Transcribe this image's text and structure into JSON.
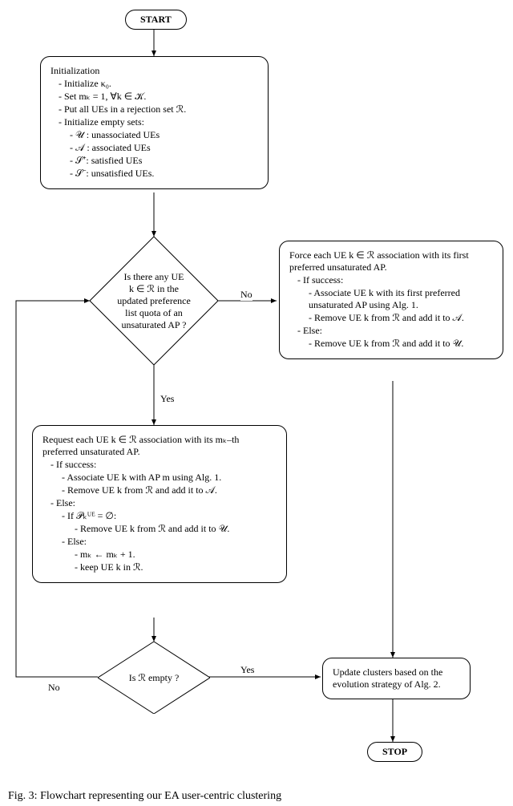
{
  "chart_data": {
    "type": "flowchart",
    "title": "Flowchart representing our EA user-centric clustering",
    "nodes": [
      {
        "id": "start",
        "type": "terminal",
        "label": "START"
      },
      {
        "id": "init",
        "type": "process",
        "label": "Initialization"
      },
      {
        "id": "dec1",
        "type": "decision",
        "label": "Is there any UE k ∈ ℛ in the updated preference list quota of an unsaturated AP ?"
      },
      {
        "id": "force",
        "type": "process",
        "label": "Force each UE k ∈ ℛ association with its first preferred unsaturated AP."
      },
      {
        "id": "request",
        "type": "process",
        "label": "Request each UE k ∈ ℛ association with its mₖ-th preferred unsaturated AP."
      },
      {
        "id": "dec2",
        "type": "decision",
        "label": "Is ℛ empty ?"
      },
      {
        "id": "update",
        "type": "process",
        "label": "Update clusters based on the evolution strategy of Alg. 2."
      },
      {
        "id": "stop",
        "type": "terminal",
        "label": "STOP"
      }
    ],
    "edges": [
      {
        "from": "start",
        "to": "init"
      },
      {
        "from": "init",
        "to": "dec1"
      },
      {
        "from": "dec1",
        "to": "force",
        "label": "No"
      },
      {
        "from": "dec1",
        "to": "request",
        "label": "Yes"
      },
      {
        "from": "request",
        "to": "dec2"
      },
      {
        "from": "dec2",
        "to": "update",
        "label": "Yes"
      },
      {
        "from": "dec2",
        "to": "dec1",
        "label": "No"
      },
      {
        "from": "force",
        "to": "update"
      },
      {
        "from": "update",
        "to": "stop"
      }
    ]
  },
  "terminal": {
    "start": "START",
    "stop": "STOP"
  },
  "init": {
    "title": "Initialization",
    "l1": "Initialize κ₀.",
    "l2": "Set mₖ = 1, ∀k ∈ 𝒦.",
    "l3": "Put all UEs in a rejection set ℛ.",
    "l4": "Initialize empty sets:",
    "s1": "𝒰 : unassociated UEs",
    "s2": "𝒜 : associated UEs",
    "s3": "𝒮⁺: satisfied UEs",
    "s4": "𝒮⁻: unsatisfied UEs."
  },
  "dec1": {
    "l1": "Is there any UE",
    "l2": "k ∈ ℛ in the",
    "l3": "updated preference",
    "l4": "list quota of an",
    "l5": "unsaturated AP ?"
  },
  "force": {
    "title": "Force each UE k ∈ ℛ association with its first preferred unsaturated AP.",
    "ifs": "If success:",
    "ifs1": "Associate UE k with its first preferred unsaturated AP using Alg. 1.",
    "ifs2": "Remove UE k from ℛ and add it to 𝒜.",
    "els": "Else:",
    "els1": "Remove UE k from ℛ and add it to 𝒰."
  },
  "request": {
    "title": "Request each UE k ∈ ℛ association with its mₖ–th preferred unsaturated AP.",
    "ifs": "If success:",
    "ifs1": "Associate UE k with AP m using Alg. 1.",
    "ifs2": "Remove UE k from ℛ and add it to 𝒜.",
    "els": "Else:",
    "pempty": "If 𝒫ₖᵁᴱ = ∅:",
    "pempty1": "Remove UE k from ℛ and add it to 𝒰.",
    "pelse": "Else:",
    "pelse1": "mₖ ← mₖ + 1.",
    "pelse2": "keep UE k in ℛ."
  },
  "dec2": {
    "text": "Is ℛ empty ?"
  },
  "update": {
    "text": "Update clusters based on the evolution strategy of Alg. 2."
  },
  "labels": {
    "no": "No",
    "yes": "Yes"
  },
  "caption": "Fig. 3: Flowchart representing our EA user-centric clustering"
}
